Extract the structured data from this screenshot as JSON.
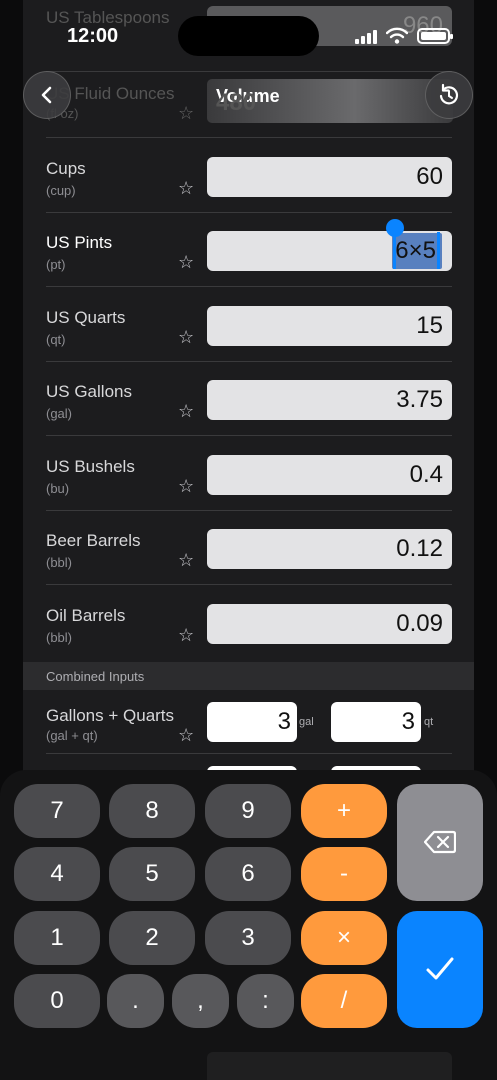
{
  "status": {
    "time": "12:00"
  },
  "nav": {
    "title": "Volume",
    "back_icon": "chevron-left-icon",
    "reset_icon": "rotate-ccw-icon"
  },
  "faded_rows": [
    {
      "name": "US Tablespoons",
      "value": "960"
    },
    {
      "name": "US Fluid Ounces",
      "abbr": "(fl oz)",
      "value": "480"
    }
  ],
  "rows": [
    {
      "name": "Cups",
      "abbr": "(cup)",
      "value": "60"
    },
    {
      "name": "US Pints",
      "abbr": "(pt)",
      "value": "6×5"
    },
    {
      "name": "US Quarts",
      "abbr": "(qt)",
      "value": "15"
    },
    {
      "name": "US Gallons",
      "abbr": "(gal)",
      "value": "3.75"
    },
    {
      "name": "US Bushels",
      "abbr": "(bu)",
      "value": "0.4"
    },
    {
      "name": "Beer Barrels",
      "abbr": "(bbl)",
      "value": "0.12"
    },
    {
      "name": "Oil Barrels",
      "abbr": "(bbl)",
      "value": "0.09"
    }
  ],
  "combined": {
    "header": "Combined Inputs",
    "name": "Gallons + Quarts",
    "abbr": "(gal + qt)",
    "first_value": "3",
    "first_unit": "gal",
    "second_value": "3",
    "second_unit": "qt"
  },
  "keypad": {
    "k7": "7",
    "k8": "8",
    "k9": "9",
    "plus": "+",
    "k4": "4",
    "k5": "5",
    "k6": "6",
    "minus": "-",
    "k1": "1",
    "k2": "2",
    "k3": "3",
    "times": "×",
    "k0": "0",
    "dot": ".",
    "comma": ",",
    "colon": ":",
    "divide": "/",
    "delete_icon": "backspace-icon",
    "confirm_icon": "checkmark-icon"
  },
  "colors": {
    "accent": "#0a84ff",
    "operator": "#ff9a3d"
  }
}
